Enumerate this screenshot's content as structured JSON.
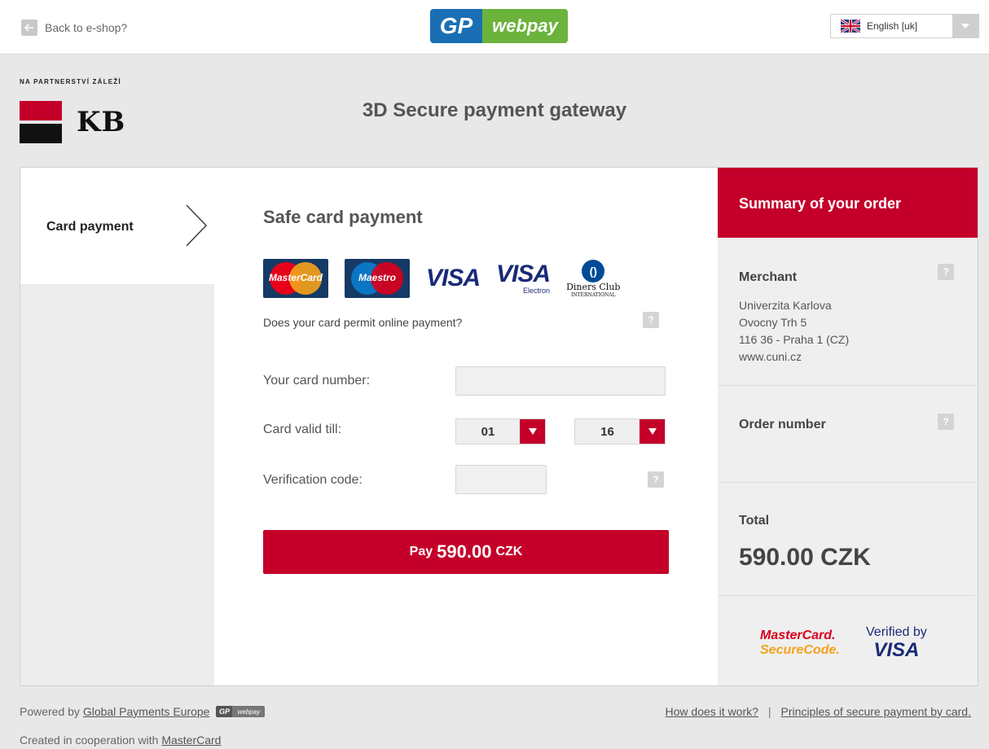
{
  "topbar": {
    "back_label": "Back to e-shop?",
    "logo_left": "GP",
    "logo_right": "webpay",
    "language": "English [uk]"
  },
  "header": {
    "tagline": "NA PARTNERSTVÍ ZÁLEŽÍ",
    "bank_logo_text": "KB",
    "title": "3D Secure payment gateway"
  },
  "steps": [
    {
      "label": "Card payment",
      "active": true
    }
  ],
  "form": {
    "title": "Safe card payment",
    "card_brands": {
      "mastercard": "MasterCard",
      "maestro": "Maestro",
      "visa": "VISA",
      "visa_electron": "VISA",
      "visa_electron_sub": "Electron",
      "diners_line1": "Diners Club",
      "diners_line2": "INTERNATIONAL"
    },
    "permit_question": "Does your card permit online payment?",
    "help_symbol": "?",
    "card_number_label": "Your card number:",
    "card_number_value": "",
    "valid_till_label": "Card valid till:",
    "month": "01",
    "year": "16",
    "date_separator": "/",
    "cvc_label": "Verification code:",
    "cvc_value": "",
    "pay_prefix": "Pay",
    "pay_amount": "590.00",
    "pay_currency": "CZK"
  },
  "summary": {
    "title": "Summary of your order",
    "merchant_title": "Merchant",
    "merchant_lines": [
      "Univerzita Karlova",
      "Ovocny Trh 5",
      "116 36 - Praha 1 (CZ)",
      "www.cuni.cz"
    ],
    "order_number_title": "Order number",
    "order_number_value": "",
    "total_title": "Total",
    "total_value": "590.00 CZK",
    "securecode_line1": "MasterCard.",
    "securecode_line2": "SecureCode.",
    "vbv_line1": "Verified by",
    "vbv_line2": "VISA"
  },
  "footer": {
    "powered_prefix": "Powered by",
    "powered_link": "Global Payments Europe",
    "cooperation_prefix": "Created in cooperation with",
    "cooperation_link": "MasterCard",
    "how_link": "How does it work?",
    "separator": "|",
    "principles_link": "Principles of secure payment by card."
  },
  "colors": {
    "accent": "#c4002a",
    "background": "#e8e8e8",
    "panel": "#ffffff",
    "gp_blue": "#1a6fb4",
    "gp_green": "#6bb33c"
  },
  "icons": {
    "back": "arrow-left-icon",
    "language_flag": "uk-flag-icon",
    "dropdown": "chevron-down-icon",
    "step": "chevron-right-icon",
    "help": "question-mark-icon"
  }
}
